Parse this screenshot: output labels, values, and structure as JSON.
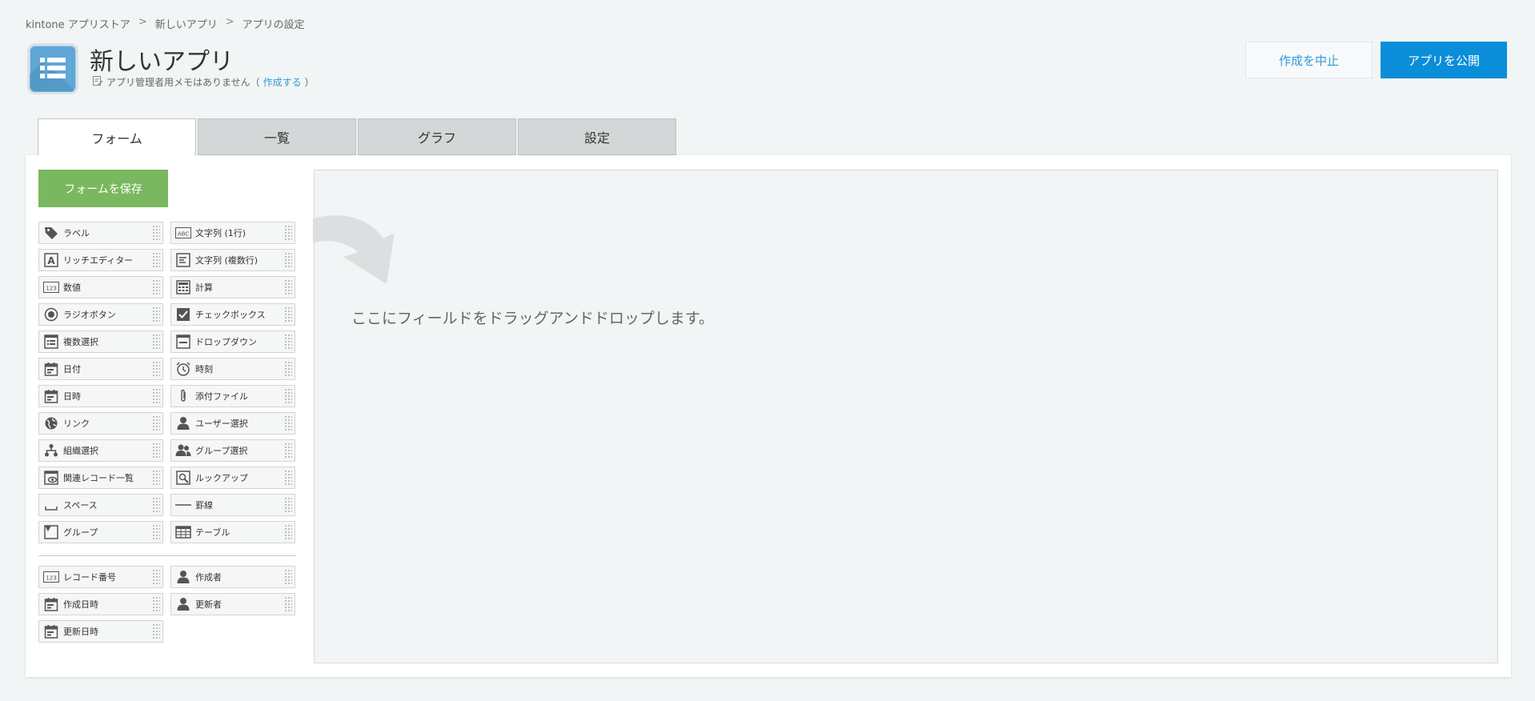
{
  "breadcrumb": [
    "kintone アプリストア",
    "新しいアプリ",
    "アプリの設定"
  ],
  "breadcrumb_sep": ">",
  "app": {
    "title": "新しいアプリ",
    "memo_text": "アプリ管理者用メモはありません（",
    "memo_link": "作成する",
    "memo_close": "）"
  },
  "actions": {
    "cancel_label": "作成を中止",
    "publish_label": "アプリを公開"
  },
  "tabs": [
    {
      "label": "フォーム",
      "active": true
    },
    {
      "label": "一覧",
      "active": false
    },
    {
      "label": "グラフ",
      "active": false
    },
    {
      "label": "設定",
      "active": false
    }
  ],
  "save_label": "フォームを保存",
  "fields": [
    {
      "label": "ラベル",
      "icon": "tag-icon"
    },
    {
      "label": "文字列 (1行)",
      "icon": "abc-icon"
    },
    {
      "label": "リッチエディター",
      "icon": "rich-editor-icon"
    },
    {
      "label": "文字列 (複数行)",
      "icon": "multiline-icon"
    },
    {
      "label": "数値",
      "icon": "number-icon"
    },
    {
      "label": "計算",
      "icon": "calculator-icon"
    },
    {
      "label": "ラジオボタン",
      "icon": "radio-icon"
    },
    {
      "label": "チェックボックス",
      "icon": "checkbox-icon"
    },
    {
      "label": "複数選択",
      "icon": "multiselect-icon"
    },
    {
      "label": "ドロップダウン",
      "icon": "dropdown-icon"
    },
    {
      "label": "日付",
      "icon": "calendar-icon"
    },
    {
      "label": "時刻",
      "icon": "clock-icon"
    },
    {
      "label": "日時",
      "icon": "calendar-icon"
    },
    {
      "label": "添付ファイル",
      "icon": "paperclip-icon"
    },
    {
      "label": "リンク",
      "icon": "globe-icon"
    },
    {
      "label": "ユーザー選択",
      "icon": "user-icon"
    },
    {
      "label": "組織選択",
      "icon": "org-icon"
    },
    {
      "label": "グループ選択",
      "icon": "group-icon"
    },
    {
      "label": "関連レコード一覧",
      "icon": "related-records-icon"
    },
    {
      "label": "ルックアップ",
      "icon": "lookup-icon"
    },
    {
      "label": "スペース",
      "icon": "space-icon"
    },
    {
      "label": "罫線",
      "icon": "line-icon"
    },
    {
      "label": "グループ",
      "icon": "group-fold-icon"
    },
    {
      "label": "テーブル",
      "icon": "table-icon"
    }
  ],
  "system_fields": [
    {
      "label": "レコード番号",
      "icon": "number-icon"
    },
    {
      "label": "作成者",
      "icon": "user-icon"
    },
    {
      "label": "作成日時",
      "icon": "calendar-icon"
    },
    {
      "label": "更新者",
      "icon": "user-icon"
    },
    {
      "label": "更新日時",
      "icon": "calendar-icon"
    }
  ],
  "drop_hint": "ここにフィールドをドラッグアンドドロップします。",
  "colors": {
    "publish": "#0a8ed9",
    "save": "#7ab85f",
    "link": "#3498db"
  }
}
